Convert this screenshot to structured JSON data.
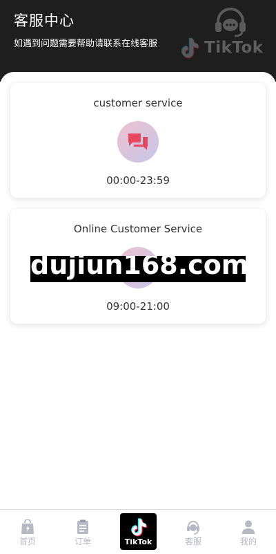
{
  "header": {
    "title": "客服中心",
    "subtitle": "如遇到问题需要帮助请联系在线客服",
    "headset_icon": "headset-icon",
    "brand_wordmark": "TikTok"
  },
  "services": [
    {
      "title": "customer service",
      "hours": "00:00-23:59",
      "icon": "chat-bubbles-icon"
    },
    {
      "title": "Online Customer Service",
      "hours": "09:00-21:00",
      "icon": "chat-bubbles-icon"
    }
  ],
  "watermark_text": "dujiun168.com",
  "tabbar": {
    "items": [
      {
        "label": "首页",
        "icon": "home-icon"
      },
      {
        "label": "订单",
        "icon": "orders-icon"
      },
      {
        "label": "客服",
        "icon": "headset-icon"
      },
      {
        "label": "我的",
        "icon": "user-icon"
      }
    ],
    "center": {
      "label": "TikTok",
      "icon": "tiktok-logo-icon"
    }
  },
  "colors": {
    "header_bg": "#1e1e1e",
    "icon_gradient_start": "#edc1cf",
    "icon_gradient_end": "#c7c7ea",
    "chat_icon": "#e8485f",
    "tab_inactive": "#b9b9c6"
  }
}
